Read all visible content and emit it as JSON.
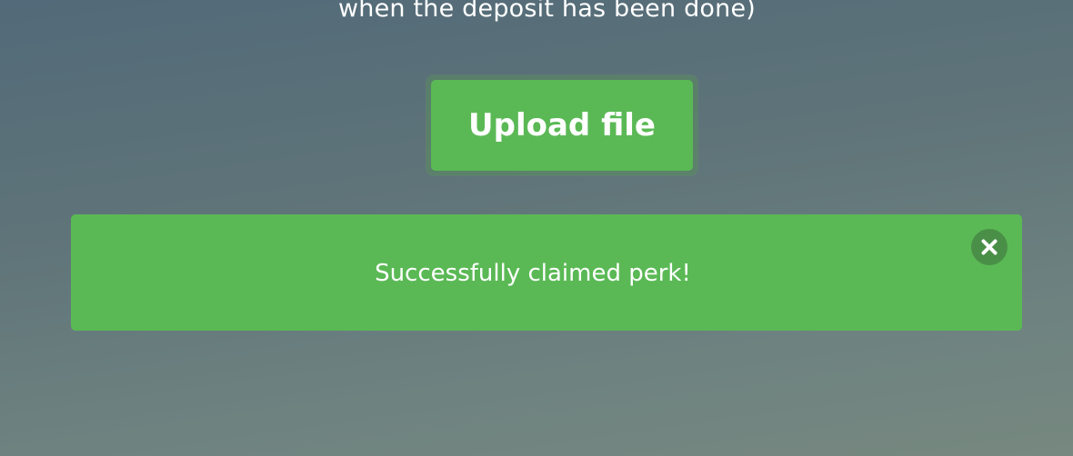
{
  "instructions": {
    "line": "when the deposit has been done)"
  },
  "upload": {
    "label": "Upload file"
  },
  "alert": {
    "message": "Successfully claimed perk!",
    "close_icon": "close-icon"
  },
  "colors": {
    "success_green": "#5ab955",
    "close_circle": "#4a8f48",
    "background_top": "#526a79",
    "background_bottom": "#76887f"
  }
}
